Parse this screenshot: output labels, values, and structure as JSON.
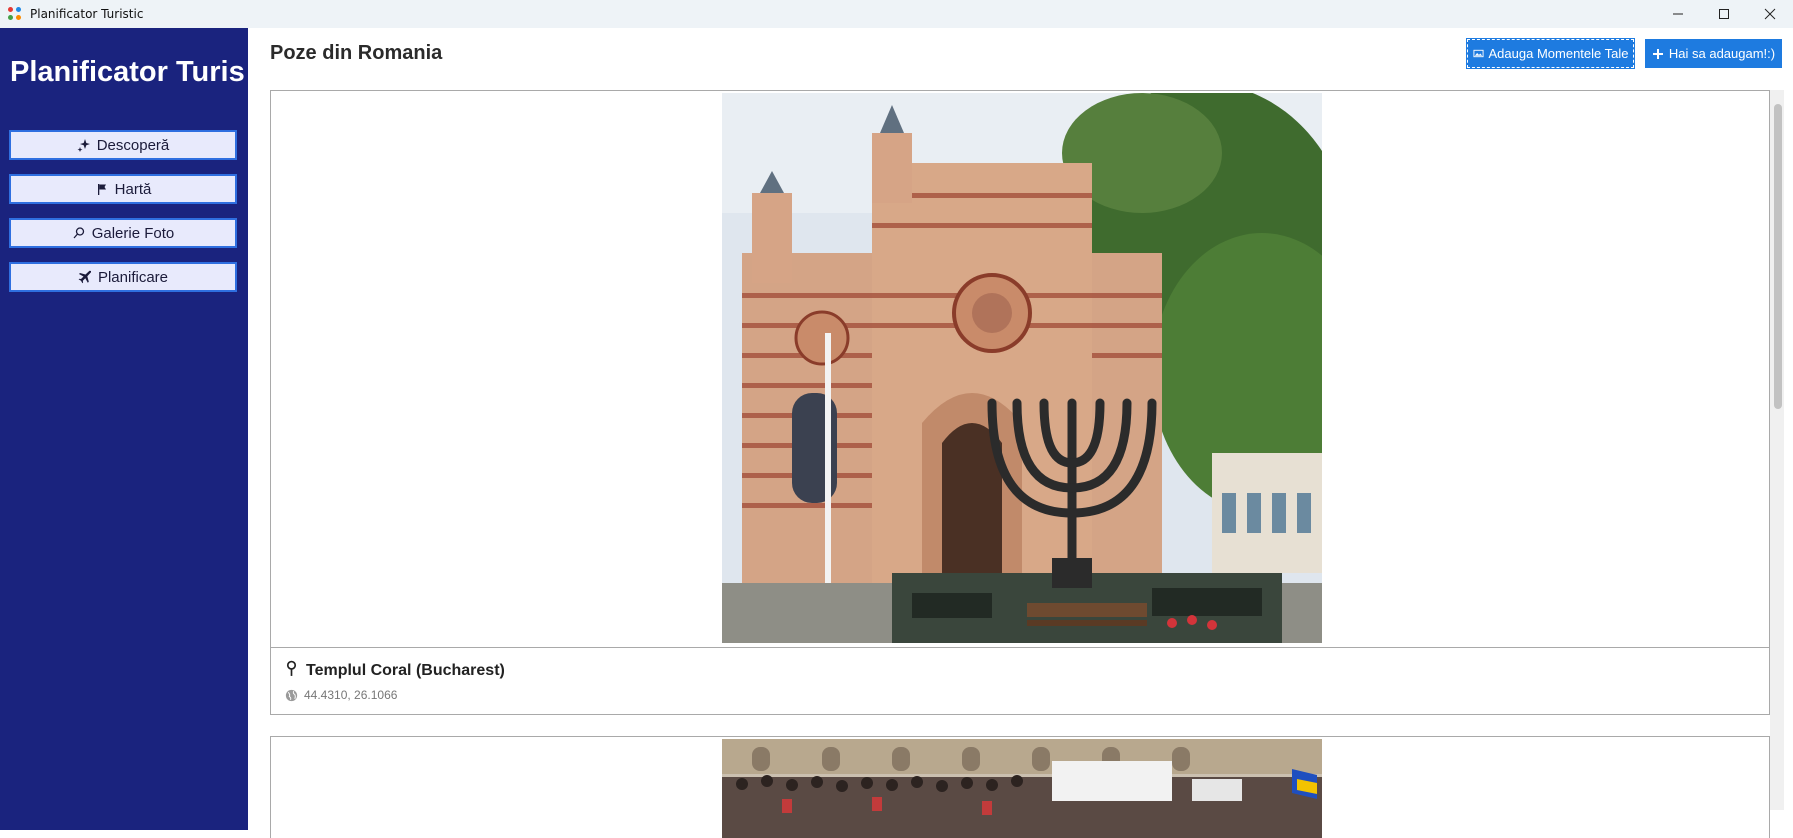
{
  "window": {
    "title": "Planificator Turistic",
    "controls": {
      "minimize_icon": "minimize-icon",
      "maximize_icon": "maximize-icon",
      "close_icon": "close-icon"
    }
  },
  "sidebar": {
    "brand": "Planificator Turis",
    "bg_color": "#1a237e",
    "items": [
      {
        "label": "Descoperă",
        "icon": "sparkles-icon"
      },
      {
        "label": "Hartă",
        "icon": "flag-icon"
      },
      {
        "label": "Galerie Foto",
        "icon": "search-icon"
      },
      {
        "label": "Planificare",
        "icon": "airplane-icon"
      }
    ]
  },
  "header": {
    "title": "Poze din Romania",
    "add_moments_label": "Adauga Momentele Tale",
    "add_label": "Hai sa adaugam!:)",
    "accent_color": "#1e7be0"
  },
  "gallery": {
    "cards": [
      {
        "photo_icon": "synagogue-photo",
        "location_name": "Templul Coral (Bucharest)",
        "coordinates": "44.4310, 26.1066"
      },
      {
        "photo_icon": "crowd-photo"
      }
    ]
  }
}
